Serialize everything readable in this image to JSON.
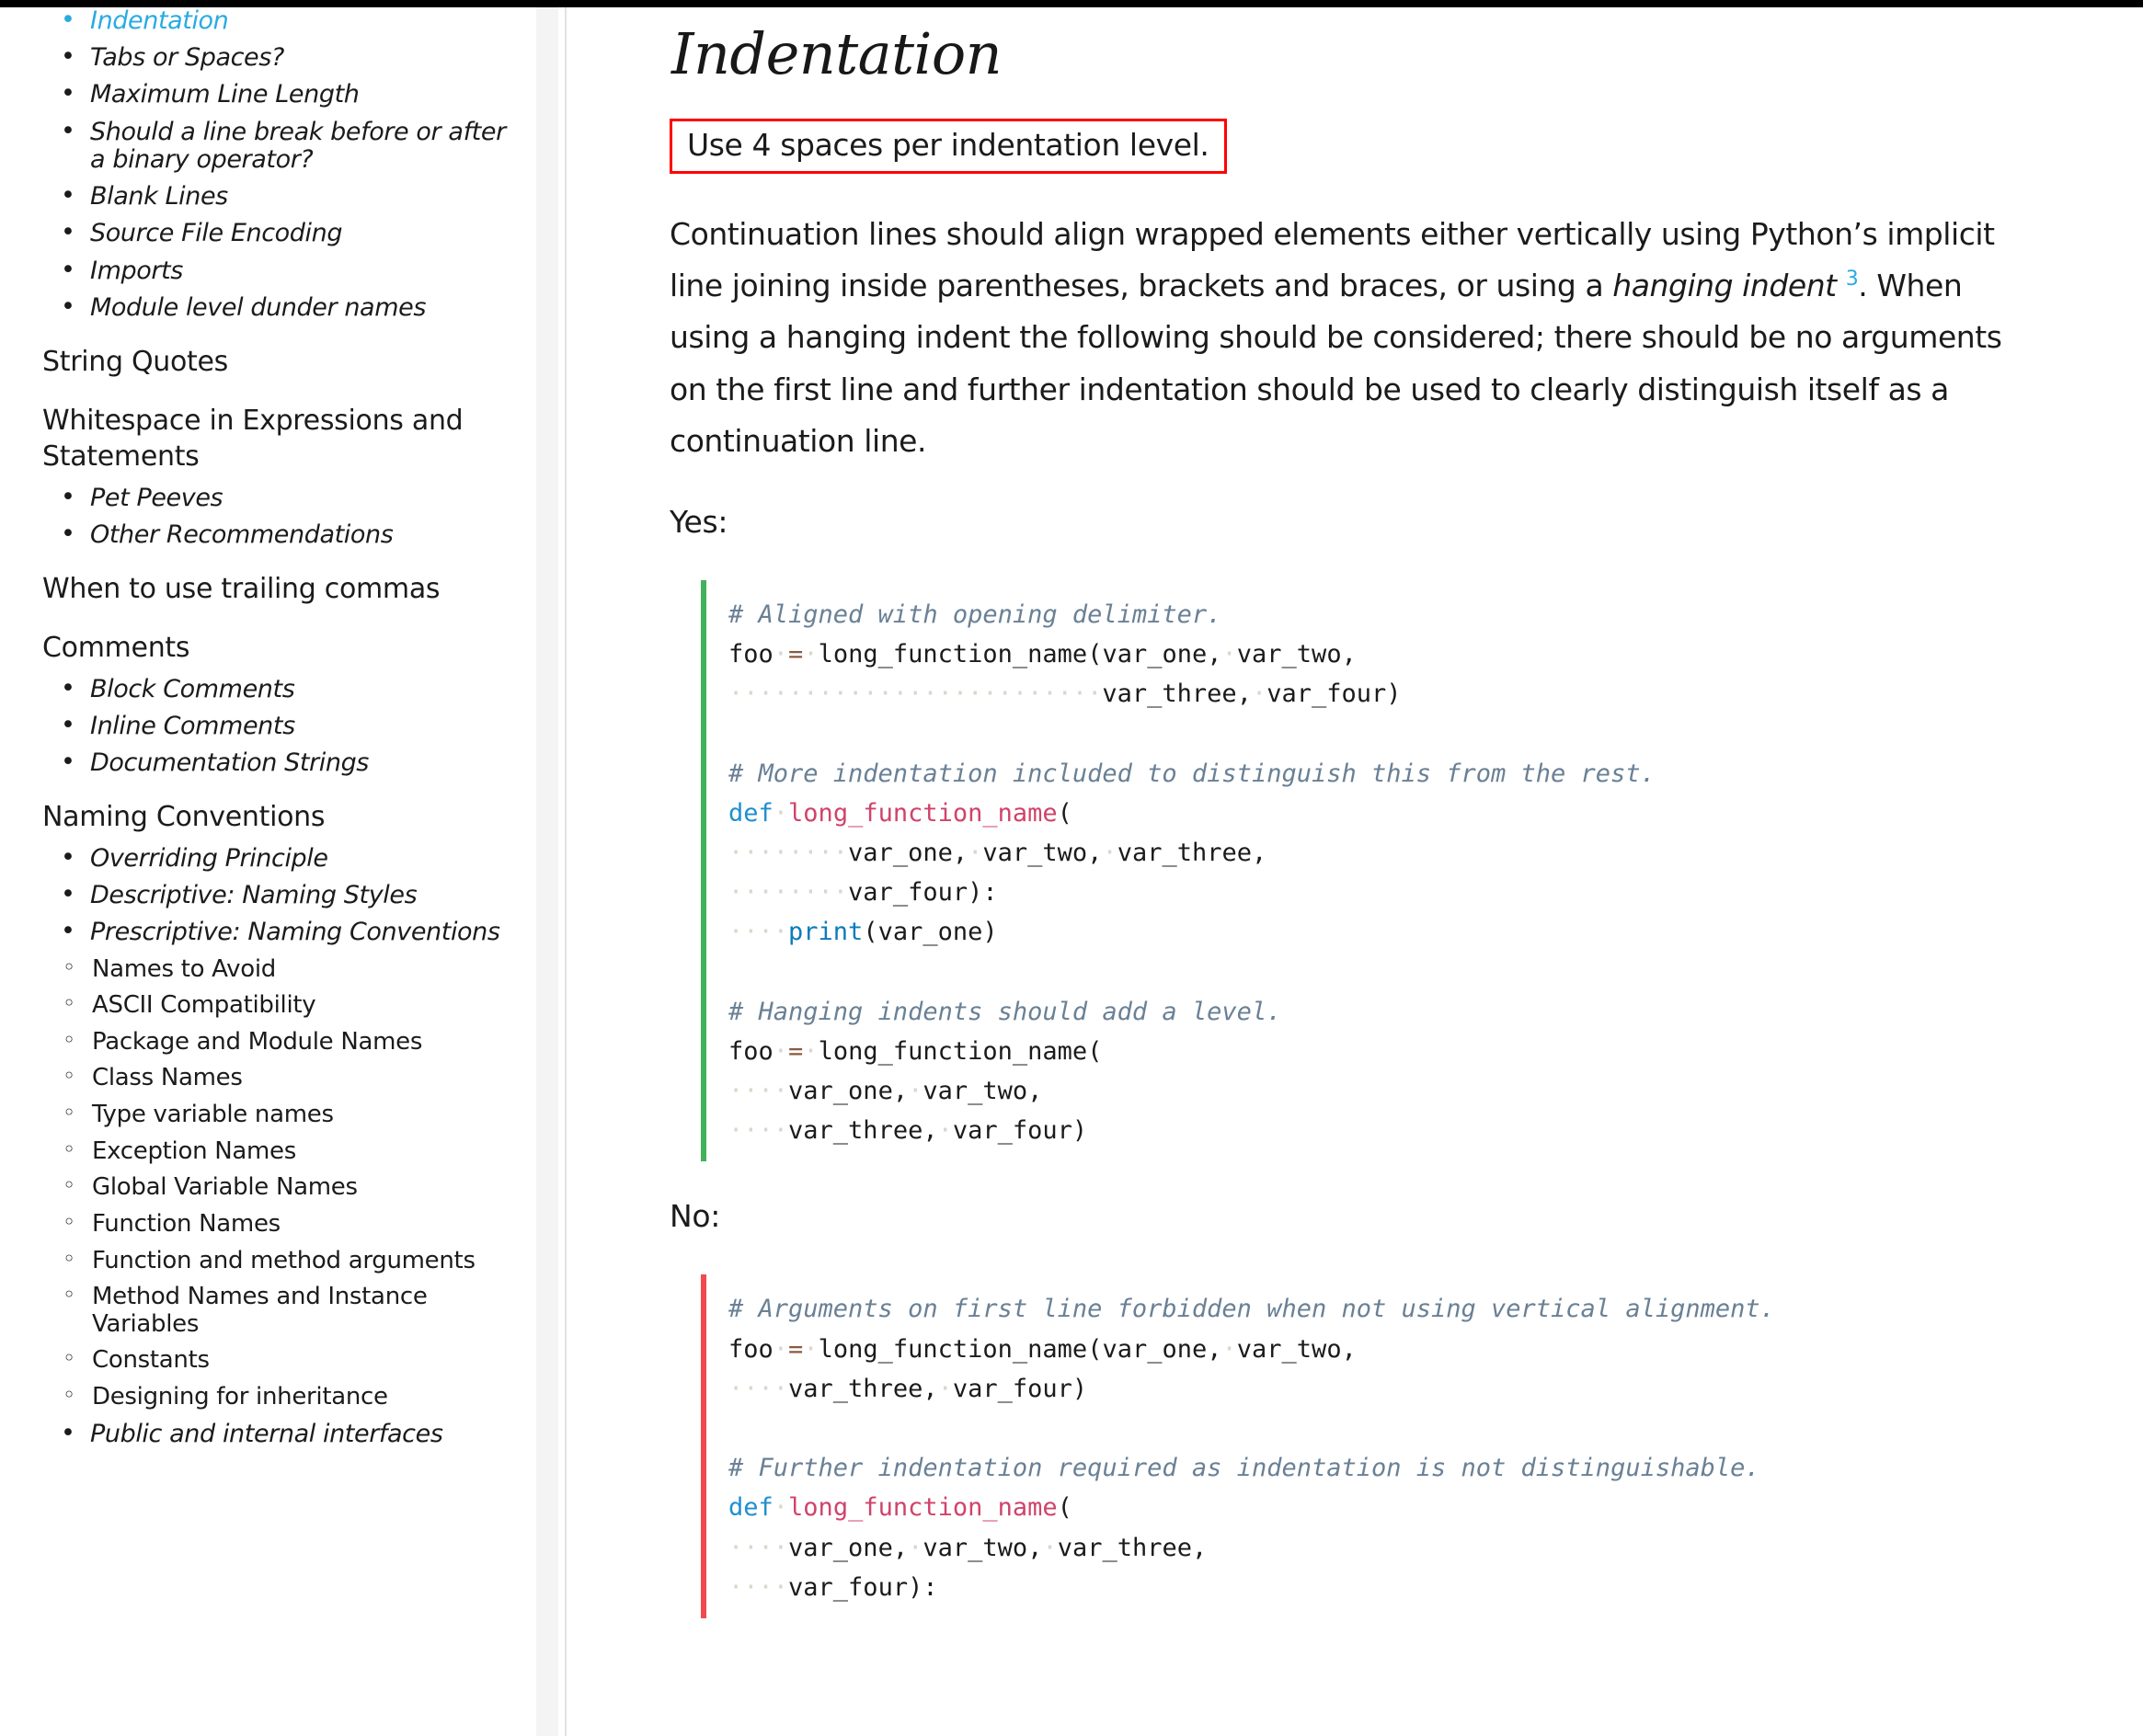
{
  "sidebar": {
    "items": [
      {
        "level": 1,
        "label": "Indentation",
        "active": true
      },
      {
        "level": 1,
        "label": "Tabs or Spaces?",
        "active": false
      },
      {
        "level": 1,
        "label": "Maximum Line Length",
        "active": false
      },
      {
        "level": 1,
        "label": "Should a line break before or after a binary operator?",
        "active": false
      },
      {
        "level": 1,
        "label": "Blank Lines",
        "active": false
      },
      {
        "level": 1,
        "label": "Source File Encoding",
        "active": false
      },
      {
        "level": 1,
        "label": "Imports",
        "active": false
      },
      {
        "level": 1,
        "label": "Module level dunder names",
        "active": false
      },
      {
        "level": 0,
        "label": "String Quotes",
        "active": false
      },
      {
        "level": 0,
        "label": "Whitespace in Expressions and Statements",
        "active": false
      },
      {
        "level": 1,
        "label": "Pet Peeves",
        "active": false
      },
      {
        "level": 1,
        "label": "Other Recommendations",
        "active": false
      },
      {
        "level": 0,
        "label": "When to use trailing commas",
        "active": false
      },
      {
        "level": 0,
        "label": "Comments",
        "active": false
      },
      {
        "level": 1,
        "label": "Block Comments",
        "active": false
      },
      {
        "level": 1,
        "label": "Inline Comments",
        "active": false
      },
      {
        "level": 1,
        "label": "Documentation Strings",
        "active": false
      },
      {
        "level": 0,
        "label": "Naming Conventions",
        "active": false
      },
      {
        "level": 1,
        "label": "Overriding Principle",
        "active": false
      },
      {
        "level": 1,
        "label": "Descriptive: Naming Styles",
        "active": false
      },
      {
        "level": 1,
        "label": "Prescriptive: Naming Conventions",
        "active": false
      },
      {
        "level": 2,
        "label": "Names to Avoid",
        "active": false
      },
      {
        "level": 2,
        "label": "ASCII Compatibility",
        "active": false
      },
      {
        "level": 2,
        "label": "Package and Module Names",
        "active": false
      },
      {
        "level": 2,
        "label": "Class Names",
        "active": false
      },
      {
        "level": 2,
        "label": "Type variable names",
        "active": false
      },
      {
        "level": 2,
        "label": "Exception Names",
        "active": false
      },
      {
        "level": 2,
        "label": "Global Variable Names",
        "active": false
      },
      {
        "level": 2,
        "label": "Function Names",
        "active": false
      },
      {
        "level": 2,
        "label": "Function and method arguments",
        "active": false
      },
      {
        "level": 2,
        "label": "Method Names and Instance Variables",
        "active": false
      },
      {
        "level": 2,
        "label": "Constants",
        "active": false
      },
      {
        "level": 2,
        "label": "Designing for inheritance",
        "active": false
      },
      {
        "level": 1,
        "label": "Public and internal interfaces",
        "active": false
      }
    ]
  },
  "main": {
    "title": "Indentation",
    "callout": "Use 4 spaces per indentation level.",
    "paragraph": {
      "part1": "Continuation lines should align wrapped elements either vertically using Python’s implicit line joining inside parentheses, brackets and braces, or using a ",
      "emphasis": "hanging indent",
      "footnote": "3",
      "part2": ". When using a hanging indent the following should be considered; there should be no arguments on the first line and further indentation should be used to clearly distinguish itself as a continuation line."
    },
    "yes_label": "Yes:",
    "no_label": "No:",
    "code_good": [
      {
        "type": "comment",
        "text": "# Aligned with opening delimiter."
      },
      {
        "type": "code",
        "text": "foo = long_function_name(var_one, var_two,"
      },
      {
        "type": "code",
        "text": "                         var_three, var_four)"
      },
      {
        "type": "blank",
        "text": ""
      },
      {
        "type": "comment",
        "text": "# More indentation included to distinguish this from the rest."
      },
      {
        "type": "code",
        "text": "def long_function_name("
      },
      {
        "type": "code",
        "text": "        var_one, var_two, var_three,"
      },
      {
        "type": "code",
        "text": "        var_four):"
      },
      {
        "type": "code",
        "text": "    print(var_one)"
      },
      {
        "type": "blank",
        "text": ""
      },
      {
        "type": "comment",
        "text": "# Hanging indents should add a level."
      },
      {
        "type": "code",
        "text": "foo = long_function_name("
      },
      {
        "type": "code",
        "text": "    var_one, var_two,"
      },
      {
        "type": "code",
        "text": "    var_three, var_four)"
      }
    ],
    "code_bad": [
      {
        "type": "comment",
        "text": "# Arguments on first line forbidden when not using vertical alignment."
      },
      {
        "type": "code",
        "text": "foo = long_function_name(var_one, var_two,"
      },
      {
        "type": "code",
        "text": "    var_three, var_four)"
      },
      {
        "type": "blank",
        "text": ""
      },
      {
        "type": "comment",
        "text": "# Further indentation required as indentation is not distinguishable."
      },
      {
        "type": "code",
        "text": "def long_function_name("
      },
      {
        "type": "code",
        "text": "    var_one, var_two, var_three,"
      },
      {
        "type": "code",
        "text": "    var_four):"
      }
    ]
  },
  "colors": {
    "link_active": "#29abe2",
    "callout_border": "#ff0000",
    "code_good_border": "#43b05c",
    "code_bad_border": "#f04a50",
    "comment": "#6a8095",
    "keyword": "#1f8fd0",
    "function": "#d0436b",
    "builtin": "#0d7bbb",
    "operator": "#8a5a42",
    "whitespace_dot": "#ded5cb"
  }
}
